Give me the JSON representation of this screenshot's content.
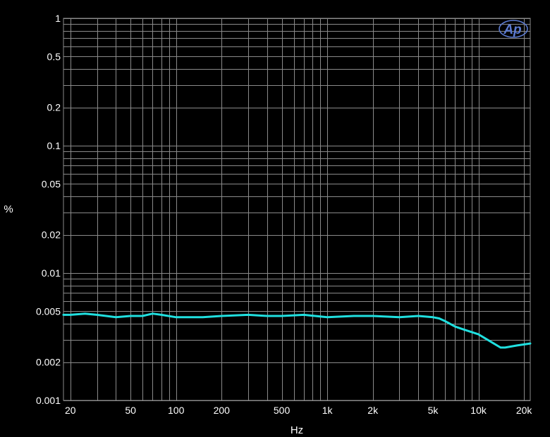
{
  "chart_data": {
    "type": "line",
    "xlabel": "Hz",
    "ylabel": "%",
    "x_scale": "log",
    "y_scale": "log",
    "xlim": [
      18,
      22000
    ],
    "ylim": [
      0.001,
      1
    ],
    "grid": true,
    "x_ticks": [
      {
        "value": 20,
        "label": "20"
      },
      {
        "value": 50,
        "label": "50"
      },
      {
        "value": 100,
        "label": "100"
      },
      {
        "value": 200,
        "label": "200"
      },
      {
        "value": 500,
        "label": "500"
      },
      {
        "value": 1000,
        "label": "1k"
      },
      {
        "value": 2000,
        "label": "2k"
      },
      {
        "value": 5000,
        "label": "5k"
      },
      {
        "value": 10000,
        "label": "10k"
      },
      {
        "value": 20000,
        "label": "20k"
      }
    ],
    "y_ticks": [
      {
        "value": 1,
        "label": "1"
      },
      {
        "value": 0.5,
        "label": "0.5"
      },
      {
        "value": 0.2,
        "label": "0.2"
      },
      {
        "value": 0.1,
        "label": "0.1"
      },
      {
        "value": 0.05,
        "label": "0.05"
      },
      {
        "value": 0.02,
        "label": "0.02"
      },
      {
        "value": 0.01,
        "label": "0.01"
      },
      {
        "value": 0.005,
        "label": "0.005"
      },
      {
        "value": 0.002,
        "label": "0.002"
      },
      {
        "value": 0.001,
        "label": "0.001"
      }
    ],
    "series": [
      {
        "color": "#20e0e0",
        "points": [
          [
            18,
            0.0047
          ],
          [
            20,
            0.0047
          ],
          [
            25,
            0.0048
          ],
          [
            30,
            0.0047
          ],
          [
            40,
            0.0045
          ],
          [
            50,
            0.0046
          ],
          [
            60,
            0.0046
          ],
          [
            70,
            0.0048
          ],
          [
            80,
            0.0047
          ],
          [
            100,
            0.0045
          ],
          [
            150,
            0.0045
          ],
          [
            200,
            0.0046
          ],
          [
            300,
            0.0047
          ],
          [
            400,
            0.0046
          ],
          [
            500,
            0.0046
          ],
          [
            700,
            0.0047
          ],
          [
            1000,
            0.0045
          ],
          [
            1500,
            0.0046
          ],
          [
            2000,
            0.0046
          ],
          [
            3000,
            0.0045
          ],
          [
            4000,
            0.0046
          ],
          [
            5000,
            0.0045
          ],
          [
            5500,
            0.0044
          ],
          [
            6000,
            0.0042
          ],
          [
            7000,
            0.0038
          ],
          [
            8000,
            0.0036
          ],
          [
            10000,
            0.0033
          ],
          [
            12000,
            0.0029
          ],
          [
            14000,
            0.0026
          ],
          [
            15000,
            0.0026
          ],
          [
            18000,
            0.0027
          ],
          [
            22000,
            0.0028
          ]
        ]
      }
    ]
  },
  "logo": {
    "text": "Ap",
    "color": "#5b7ad0"
  }
}
